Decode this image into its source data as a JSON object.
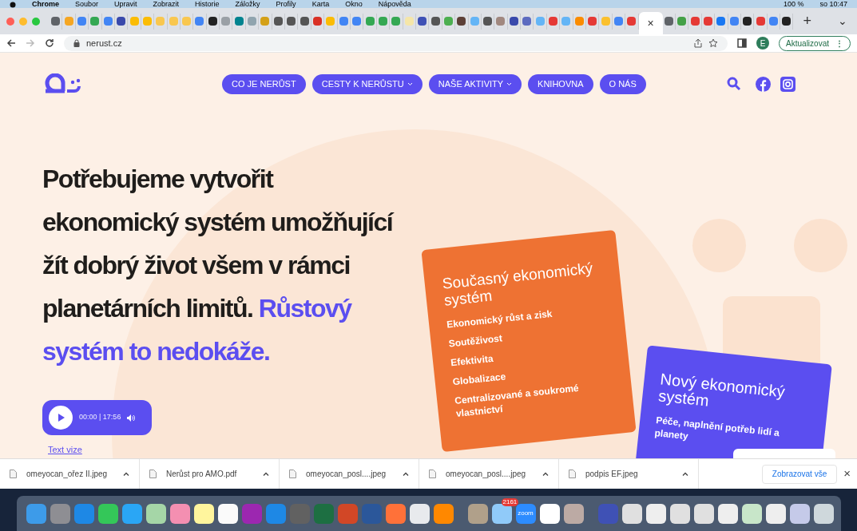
{
  "menu_bar": {
    "app": "Chrome",
    "items": [
      "Soubor",
      "Upravit",
      "Zobrazit",
      "Historie",
      "Záložky",
      "Profily",
      "Karta",
      "Okno",
      "Nápověda"
    ],
    "battery": "100 %",
    "clock": "so 10:47"
  },
  "tabs": [
    {
      "color": "#5f6368",
      "selected": false
    },
    {
      "color": "#f5a623",
      "selected": false
    },
    {
      "color": "#4285f4",
      "selected": false
    },
    {
      "color": "#34a853",
      "selected": false
    },
    {
      "color": "#4285f4",
      "selected": false
    },
    {
      "color": "#3949ab",
      "selected": false
    },
    {
      "color": "#fbbc04",
      "selected": false
    },
    {
      "color": "#fbbc04",
      "selected": false
    },
    {
      "color": "#f9c74f",
      "selected": false
    },
    {
      "color": "#f9c74f",
      "selected": false
    },
    {
      "color": "#f9c74f",
      "selected": false
    },
    {
      "color": "#4285f4",
      "selected": false
    },
    {
      "color": "#222222",
      "selected": false
    },
    {
      "color": "#9aa0a6",
      "selected": false
    },
    {
      "color": "#00838f",
      "selected": false
    },
    {
      "color": "#90a4ae",
      "selected": false
    },
    {
      "color": "#d4a017",
      "selected": false
    },
    {
      "color": "#555555",
      "selected": false
    },
    {
      "color": "#555555",
      "selected": false
    },
    {
      "color": "#555555",
      "selected": false
    },
    {
      "color": "#d93025",
      "selected": false
    },
    {
      "color": "#fbbc04",
      "selected": false
    },
    {
      "color": "#4285f4",
      "selected": false
    },
    {
      "color": "#4285f4",
      "selected": false
    },
    {
      "color": "#34a853",
      "selected": false
    },
    {
      "color": "#34a853",
      "selected": false
    },
    {
      "color": "#34a853",
      "selected": false
    },
    {
      "color": "#f5e6a8",
      "selected": false
    },
    {
      "color": "#3f51b5",
      "selected": false
    },
    {
      "color": "#555555",
      "selected": false
    },
    {
      "color": "#4caf50",
      "selected": false
    },
    {
      "color": "#5d4037",
      "selected": false
    },
    {
      "color": "#64b5f6",
      "selected": false
    },
    {
      "color": "#555555",
      "selected": false
    },
    {
      "color": "#a1887f",
      "selected": false
    },
    {
      "color": "#3949ab",
      "selected": false
    },
    {
      "color": "#5c6bc0",
      "selected": false
    },
    {
      "color": "#64b5f6",
      "selected": false
    },
    {
      "color": "#e53935",
      "selected": false
    },
    {
      "color": "#64b5f6",
      "selected": false
    },
    {
      "color": "#fb8c00",
      "selected": false
    },
    {
      "color": "#e53935",
      "selected": false
    },
    {
      "color": "#fbc02d",
      "selected": false
    },
    {
      "color": "#4285f4",
      "selected": false
    },
    {
      "color": "#e53935",
      "selected": false
    },
    {
      "selected": true,
      "close": "×"
    },
    {
      "color": "#5f6368",
      "selected": false
    },
    {
      "color": "#43a047",
      "selected": false
    },
    {
      "color": "#e53935",
      "selected": false
    },
    {
      "color": "#e53935",
      "selected": false
    },
    {
      "color": "#1877f2",
      "selected": false
    },
    {
      "color": "#4285f4",
      "selected": false
    },
    {
      "color": "#222222",
      "selected": false
    },
    {
      "color": "#e53935",
      "selected": false
    },
    {
      "color": "#4285f4",
      "selected": false
    },
    {
      "color": "#222222",
      "selected": false
    }
  ],
  "new_tab": "+",
  "tab_list": "⌄",
  "address_bar": {
    "url": "nerust.cz",
    "profile": "E",
    "update_button": "Aktualizovat",
    "menu": "⋮"
  },
  "site": {
    "nav": [
      {
        "label": "CO JE NERŮST",
        "dropdown": false
      },
      {
        "label": "CESTY K NERŮSTU",
        "dropdown": true
      },
      {
        "label": "NAŠE AKTIVITY",
        "dropdown": true
      },
      {
        "label": "KNIHOVNA",
        "dropdown": false
      },
      {
        "label": "O NÁS",
        "dropdown": false
      }
    ],
    "headline_lines": [
      "Potřebujeme vytvořit",
      "ekonomický systém umožňující",
      "žít dobrý život všem v rámci",
      "planetárních limitů. *Růstový*",
      "*systém to nedokáže.*"
    ],
    "audio_player": {
      "time": "00:00 | 17:56"
    },
    "text_link": "Text vize",
    "current_card": {
      "title": "Současný ekonomický systém",
      "items": [
        "Ekonomický růst a zisk",
        "Soutěživost",
        "Efektivita",
        "Globalizace",
        "Centralizované a soukromé vlastnictví"
      ]
    },
    "new_card": {
      "title": "Nový ekonomický systém",
      "items": [
        "Péče, naplnění potřeb lidí a planety"
      ]
    }
  },
  "downloads": {
    "items": [
      "omeyocan_ořez II.jpeg",
      "Nerůst pro AMO.pdf",
      "omeyocan_posl....jpeg",
      "omeyocan_posl....jpeg",
      "podpis EF.jpeg"
    ],
    "show_all": "Zobrazovat vše",
    "close": "×"
  },
  "dock": {
    "apps": [
      {
        "color": "#3d9be9"
      },
      {
        "color": "#8e8e93"
      },
      {
        "color": "#1e88e5"
      },
      {
        "color": "#34c759"
      },
      {
        "color": "#2aa6f5"
      },
      {
        "color": "#a5d6a7"
      },
      {
        "color": "#f48fb1"
      },
      {
        "color": "#fff59d"
      },
      {
        "color": "#fafafa"
      },
      {
        "color": "#9c27b0"
      },
      {
        "color": "#1e88e5"
      },
      {
        "color": "#616161"
      },
      {
        "color": "#1d6f42"
      },
      {
        "color": "#d24726"
      },
      {
        "color": "#2b579a"
      },
      {
        "color": "#ff7139"
      },
      {
        "color": "#e8eaed"
      },
      {
        "color": "#ff8800"
      }
    ],
    "recent": [
      {
        "color": "#b0a08a"
      },
      {
        "color": "#90caf9",
        "badge": "2161"
      },
      {
        "color": "#2d8cff",
        "label": "zoom"
      },
      {
        "color": "#ffffff"
      },
      {
        "color": "#bcaaa4"
      }
    ],
    "documents": [
      {
        "color": "#3f51b5"
      },
      {
        "color": "#e0e0e0"
      },
      {
        "color": "#eeeeee"
      },
      {
        "color": "#e0e0e0"
      },
      {
        "color": "#e0e0e0"
      },
      {
        "color": "#eeeeee"
      },
      {
        "color": "#c8e6c9"
      },
      {
        "color": "#eeeeee"
      },
      {
        "color": "#c5cae9"
      },
      {
        "color": "#cfd8dc"
      }
    ]
  }
}
